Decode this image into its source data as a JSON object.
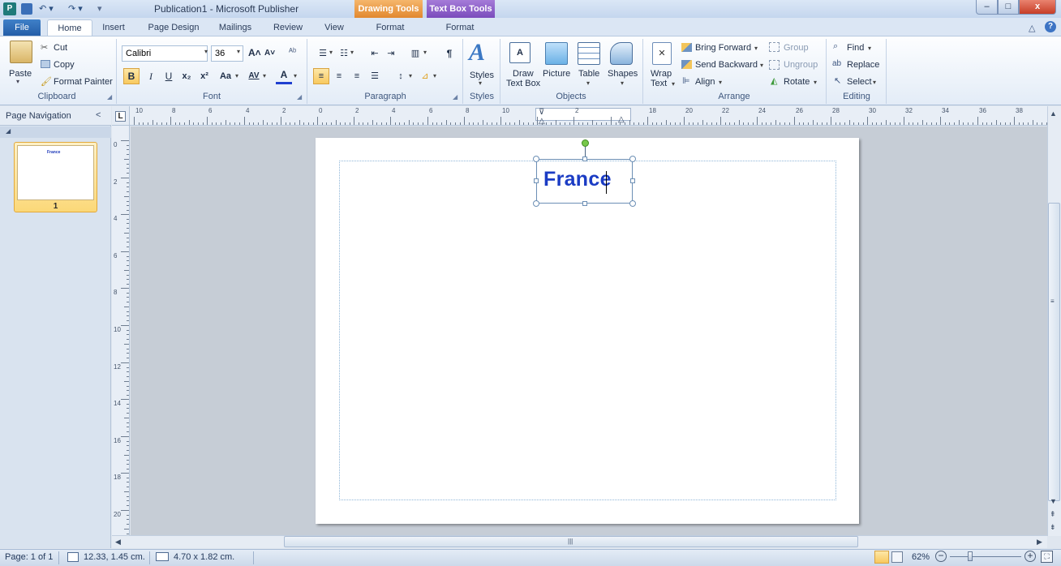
{
  "title_bar": {
    "app_icon_letter": "P",
    "qat": {
      "undo": "↶ ▾",
      "redo": "↷ ▾",
      "customize": "▾"
    },
    "window_title": "Publication1 - Microsoft Publisher",
    "contextual_tabs": [
      "Drawing Tools",
      "Text Box Tools"
    ],
    "window_buttons": {
      "minimize": "–",
      "maximize": "□",
      "close": "x"
    }
  },
  "tabs": {
    "file": "File",
    "items": [
      "Home",
      "Insert",
      "Page Design",
      "Mailings",
      "Review",
      "View"
    ],
    "contextual": [
      "Format",
      "Format"
    ],
    "active": "Home"
  },
  "ribbon": {
    "clipboard": {
      "label": "Clipboard",
      "paste": "Paste",
      "cut": "Cut",
      "copy": "Copy",
      "format_painter": "Format Painter"
    },
    "font": {
      "label": "Font",
      "font_name": "Calibri",
      "font_size": "36",
      "bold": "B",
      "italic": "I",
      "underline": "U",
      "subscript": "x₂",
      "superscript": "x²",
      "change_case": "Aa",
      "spacing": "AV",
      "font_color": "A"
    },
    "paragraph": {
      "label": "Paragraph",
      "pilcrow": "¶"
    },
    "styles": {
      "label": "Styles",
      "button": "Styles"
    },
    "objects": {
      "label": "Objects",
      "draw_text_box_1": "Draw",
      "draw_text_box_2": "Text Box",
      "picture": "Picture",
      "table": "Table",
      "shapes": "Shapes"
    },
    "arrange": {
      "label": "Arrange",
      "wrap_text_1": "Wrap",
      "wrap_text_2": "Text",
      "bring_forward": "Bring Forward",
      "send_backward": "Send Backward",
      "align": "Align",
      "group": "Group",
      "ungroup": "Ungroup",
      "rotate": "Rotate"
    },
    "editing": {
      "label": "Editing",
      "find": "Find",
      "replace": "Replace",
      "select": "Select"
    }
  },
  "nav_pane": {
    "title": "Page Navigation",
    "collapse": "<",
    "thumb_text": "France",
    "page_number": "1"
  },
  "rulers": {
    "tab_stop": "L",
    "h_labels": [
      "10",
      "8",
      "6",
      "4",
      "2",
      "0",
      "2",
      "4",
      "6",
      "8",
      "10",
      "",
      "2",
      "",
      "18",
      "20",
      "22",
      "24",
      "26",
      "28",
      "30",
      "32",
      "34",
      "36",
      "38"
    ],
    "v_labels": [
      "0",
      "2",
      "4",
      "6",
      "8",
      "10",
      "12",
      "14",
      "16",
      "18",
      "20"
    ]
  },
  "document": {
    "textbox_text": "France"
  },
  "status_bar": {
    "page": "Page: 1 of 1",
    "position": "12.33, 1.45 cm.",
    "size": "4.70 x 1.82 cm.",
    "zoom": "62%",
    "zoom_out": "−",
    "zoom_in": "+"
  },
  "colors": {
    "file_tab": "#2f6fba",
    "drawing_tools": "#e8953d",
    "text_box_tools": "#8a5cc8",
    "text_blue": "#1b3cc4",
    "thumb_highlight": "#fbd878"
  }
}
